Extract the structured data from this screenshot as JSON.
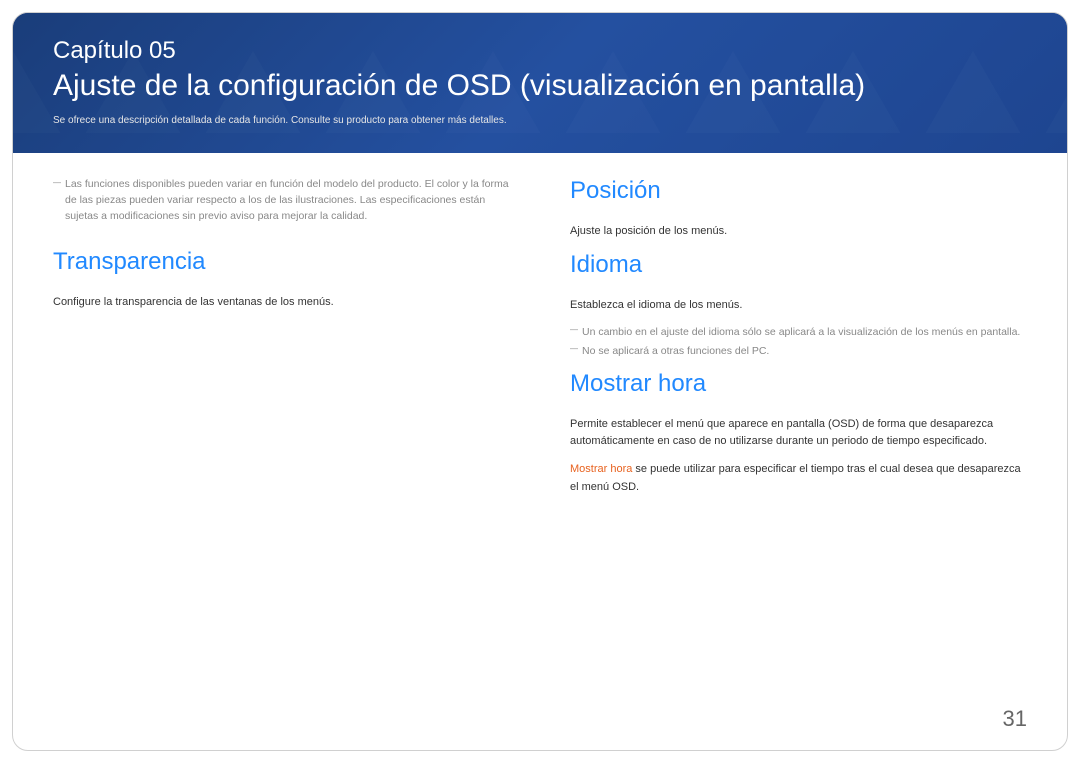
{
  "header": {
    "chapter_label": "Capítulo 05",
    "title": "Ajuste de la configuración de OSD (visualización en pantalla)",
    "subtitle": "Se ofrece una descripción detallada de cada función. Consulte su producto para obtener más detalles."
  },
  "left": {
    "top_note": "Las funciones disponibles pueden variar en función del modelo del producto. El color y la forma de las piezas pueden variar respecto a los de las ilustraciones. Las especificaciones están sujetas a modificaciones sin previo aviso para mejorar la calidad.",
    "transparencia": {
      "heading": "Transparencia",
      "body": "Configure la transparencia de las ventanas de los menús."
    }
  },
  "right": {
    "posicion": {
      "heading": "Posición",
      "body": "Ajuste la posición de los menús."
    },
    "idioma": {
      "heading": "Idioma",
      "body": "Establezca el idioma de los menús.",
      "note1": "Un cambio en el ajuste del idioma sólo se aplicará a la visualización de los menús en pantalla.",
      "note2": "No se aplicará a otras funciones del PC."
    },
    "mostrar_hora": {
      "heading": "Mostrar hora",
      "body1": "Permite establecer el menú que aparece en pantalla (OSD) de forma que desaparezca automáticamente en caso de no utilizarse durante un periodo de tiempo especificado.",
      "highlight": "Mostrar hora",
      "body2_rest": " se puede utilizar para especificar el tiempo tras el cual desea que desaparezca el menú OSD."
    }
  },
  "page_number": "31"
}
